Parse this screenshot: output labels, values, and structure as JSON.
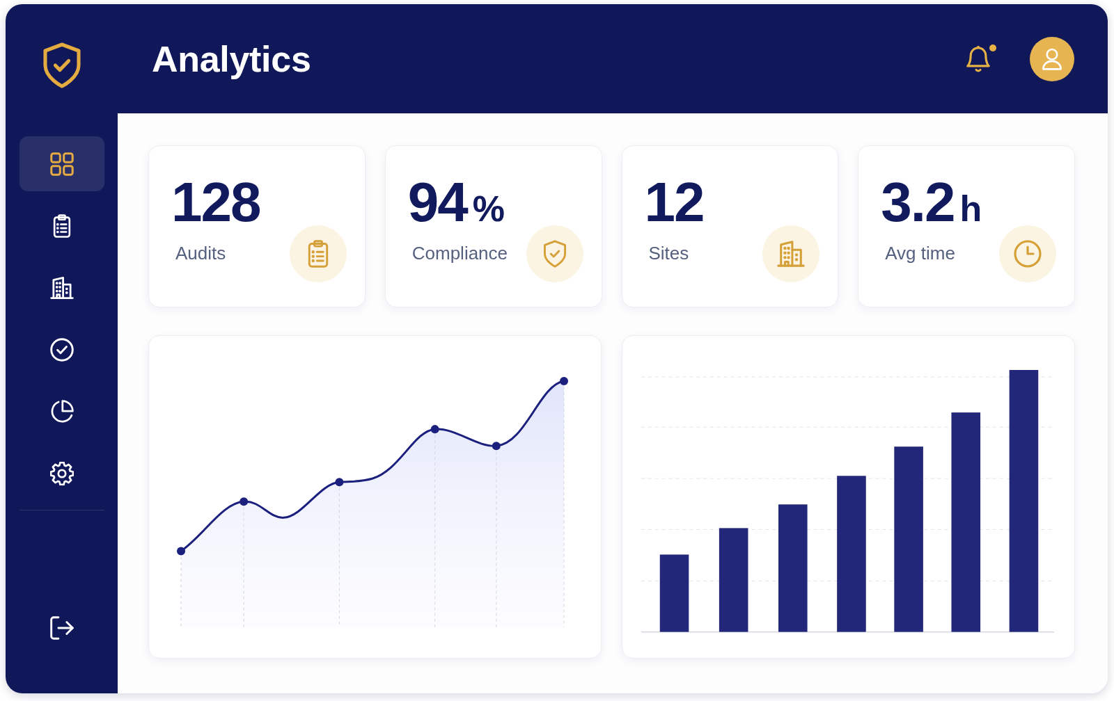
{
  "sidebar": {
    "items": [
      {
        "selected": true
      },
      {
        "selected": false
      },
      {
        "selected": false
      },
      {
        "selected": false
      },
      {
        "selected": false
      },
      {
        "selected": false
      }
    ]
  },
  "header": {
    "title": "Analytics",
    "has_unread_notifications": true
  },
  "stats": [
    {
      "value": "128",
      "label": "Audits"
    },
    {
      "value": "94",
      "unit": "%",
      "label": "Compliance"
    },
    {
      "value": "12",
      "label": "Sites"
    },
    {
      "value": "3.2",
      "unit": "h",
      "label": "Avg time"
    }
  ]
}
